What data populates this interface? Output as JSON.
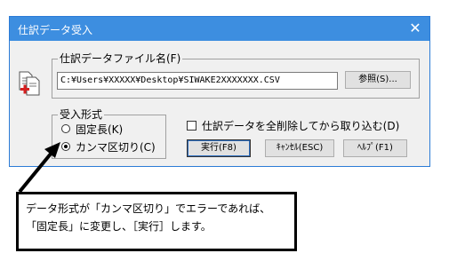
{
  "dialog": {
    "title": "仕訳データ受入",
    "close_glyph": "✕",
    "file_group": {
      "label": "仕訳データファイル名(F)",
      "path_value": "C:¥Users¥XXXXX¥Desktop¥SIWAKE2XXXXXXX.CSV",
      "browse_label": "参照(S)..."
    },
    "format_group": {
      "label": "受入形式",
      "options": [
        {
          "label": "固定長(K)",
          "selected": false
        },
        {
          "label": "カンマ区切り(C)",
          "selected": true
        }
      ]
    },
    "delete_checkbox_label": "仕訳データを全削除してから取り込む(D)",
    "buttons": {
      "run": "実行(F8)",
      "cancel": "ｷｬﾝｾﾙ(ESC)",
      "help": "ﾍﾙﾌﾟ(F1)"
    }
  },
  "callout": {
    "line1": "データ形式が「カンマ区切り」でエラーであれば、",
    "line2": "「固定長」に変更し、［実行］します。"
  },
  "colors": {
    "titlebar": "#3d8ee0",
    "dialog_bg": "#f0f0f0"
  }
}
